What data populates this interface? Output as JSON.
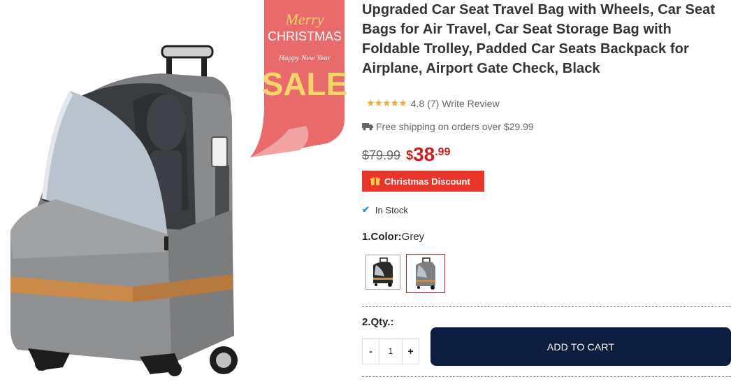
{
  "product": {
    "title": "Upgraded Car Seat Travel Bag with Wheels, Car Seat Bags for Air Travel, Car Seat Storage Bag with Foldable Trolley, Padded Car Seats Backpack for Airplane, Airport Gate Check, Black",
    "image_alt": "Grey car seat travel bag with wheels and trolley handle",
    "promo": {
      "line1": "Merry",
      "line2": "CHRISTMAS",
      "line3": "Happy New Year",
      "line4": "SALE"
    }
  },
  "rating": {
    "stars": "★★★★★",
    "value": "4.8",
    "count": "(7)",
    "write_review": "Write Review"
  },
  "shipping": {
    "text": "Free shipping on orders over $29.99",
    "icon": "truck-icon"
  },
  "price": {
    "old": "$79.99",
    "currency": "$",
    "integer": "38",
    "decimal": ".99"
  },
  "discount": {
    "label": "Christmas Discount",
    "icon": "gift-icon"
  },
  "stock": {
    "icon": "check-icon",
    "text": "In Stock"
  },
  "color": {
    "label": "1.Color:",
    "value": "Grey",
    "options": [
      {
        "name": "Black",
        "selected": false
      },
      {
        "name": "Grey",
        "selected": true
      }
    ]
  },
  "quantity": {
    "label": "2.Qty.:",
    "minus": "-",
    "value": "1",
    "plus": "+"
  },
  "cart": {
    "button": "ADD TO CART"
  },
  "colors": {
    "price_red": "#cc1f1f",
    "discount_bg": "#e8362b",
    "cart_bg": "#0c1d3f",
    "star": "#f4a938",
    "check": "#2e8fd8"
  }
}
